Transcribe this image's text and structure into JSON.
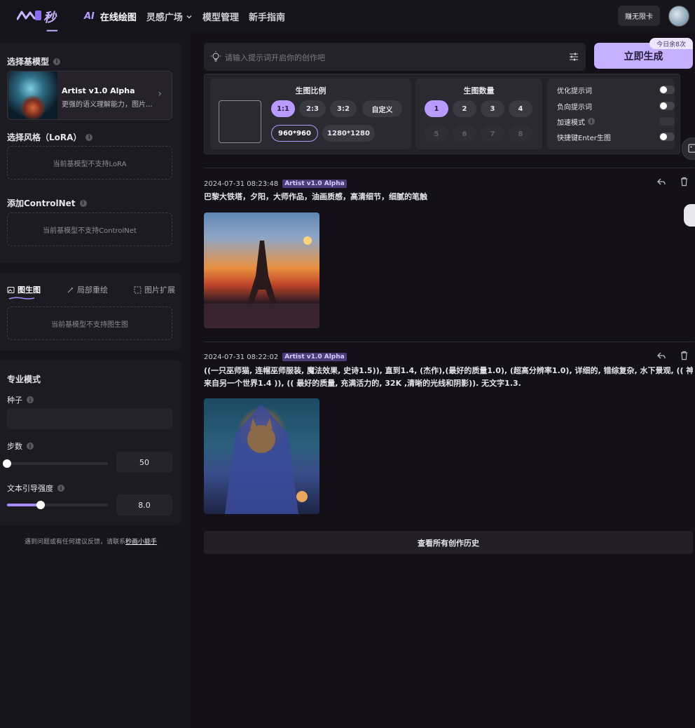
{
  "header": {
    "logo_text": "秒画",
    "nav": {
      "ai": "AI",
      "online": "在线绘图",
      "inspiration": "灵感广场",
      "models": "模型管理",
      "guide": "新手指南"
    },
    "vip_button": "赚无限卡"
  },
  "sidebar": {
    "base_model_label": "选择基模型",
    "model": {
      "name": "Artist v1.0 Alpha",
      "desc": "更强的语义理解能力，图片..."
    },
    "lora_label": "选择风格（LoRA）",
    "lora_unsupported": "当前基模型不支持LoRA",
    "controlnet_label": "添加ControlNet",
    "controlnet_unsupported": "当前基模型不支持ControlNet",
    "tabs": {
      "img2img": "图生图",
      "inpaint": "局部重绘",
      "outpaint": "图片扩展"
    },
    "img2img_unsupported": "当前基模型不支持图生图",
    "pro_mode_label": "专业模式",
    "seed_label": "种子",
    "steps_label": "步数",
    "steps_value": "50",
    "steps_fraction": 0.0,
    "guidance_label": "文本引导强度",
    "guidance_value": "8.0",
    "guidance_fraction": 0.33,
    "footer": {
      "text": "遇到问题或有任何建议反馈，请联系",
      "link": "秒画小能手"
    }
  },
  "main": {
    "prompt_placeholder": "请输入提示词开启你的创作吧",
    "generate_button": "立即生成",
    "quota_badge": "今日余8次",
    "ratio": {
      "title": "生图比例",
      "options": [
        "1:1",
        "2:3",
        "3:2",
        "自定义"
      ],
      "selected": "1:1",
      "sizes": [
        "960*960",
        "1280*1280"
      ],
      "selected_size": "960*960"
    },
    "count": {
      "title": "生图数量",
      "options": [
        "1",
        "2",
        "3",
        "4",
        "5",
        "6",
        "7",
        "8"
      ],
      "selected": "1"
    },
    "toggles": [
      {
        "label": "优化提示词",
        "on": false
      },
      {
        "label": "负向提示词",
        "on": false
      },
      {
        "label": "加速模式",
        "on": false,
        "disabled": true
      },
      {
        "label": "快捷键Enter生图",
        "on": false
      }
    ],
    "history": [
      {
        "time": "2024-07-31 08:23:48",
        "tag": "Artist v1.0 Alpha",
        "prompt": "巴黎大铁塔，夕阳，大师作品，油画质感，高清细节，细腻的笔触"
      },
      {
        "time": "2024-07-31 08:22:02",
        "tag": "Artist v1.0 Alpha",
        "prompt_line1": "((一只巫师猫, 连帽巫师服装, 魔法效果, 史诗1.5)), 直到1.4, (杰作),(最好的质量1.0), (超高分辨率1.0), 详细的, 错综复杂, 水下景观, (( 神奇, 美丽的,",
        "prompt_line2": "来自另一个世界1.4 )), (( 最好的质量, 充满活力的, 32K ,清晰的光线和阴影)). 无文字1.3."
      }
    ],
    "view_history_button": "查看所有创作历史"
  }
}
